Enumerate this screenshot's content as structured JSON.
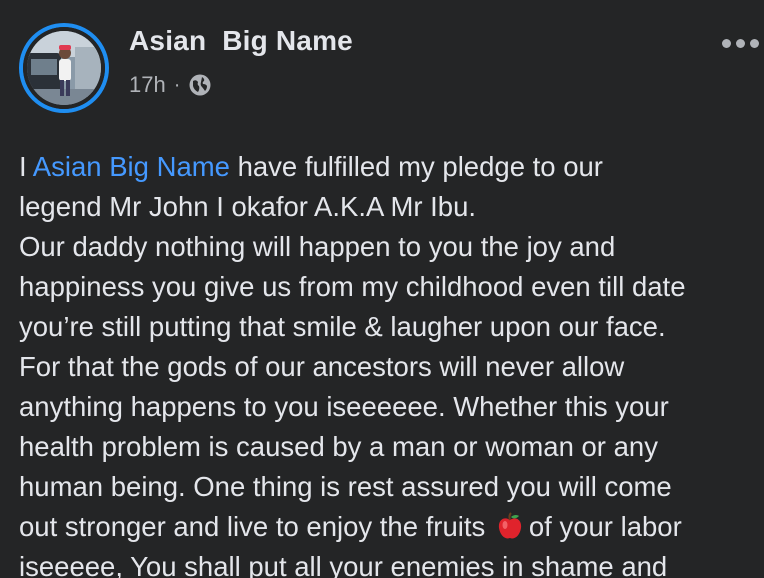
{
  "post": {
    "author": "Asian  Big Name",
    "time": "17h",
    "separator": "·",
    "privacy_icon": "globe-icon",
    "more_icon": "more-options-icon",
    "colors": {
      "background": "#242526",
      "text": "#e4e6eb",
      "secondary_text": "#b0b3b8",
      "mention": "#4599ff",
      "avatar_ring": "#1f8ef1"
    },
    "lines": {
      "l1_pre": "I ",
      "l1_mention": "Asian  Big Name",
      "l1_post": " have fulfilled my pledge to our",
      "l2": "legend Mr John I okafor A.K.A Mr Ibu.",
      "l3": "Our daddy nothing will happen to you the joy and",
      "l4": "happiness you give us from my childhood even till date",
      "l5": "you’re still putting that smile & laugher upon our face.",
      "l6": "For that the gods of our ancestors will never allow",
      "l7": "anything happens to you iseeeeee.  Whether this your",
      "l8": "health problem is caused by a man or woman or any",
      "l9": "human being. One thing is rest assured you will come",
      "l10_pre": "out stronger and live to enjoy the fruits",
      "l10_emoji": "apple-emoji",
      "l10_post": "of your labor",
      "l11": "iseeeee, You shall put all your enemies in shame and"
    }
  }
}
